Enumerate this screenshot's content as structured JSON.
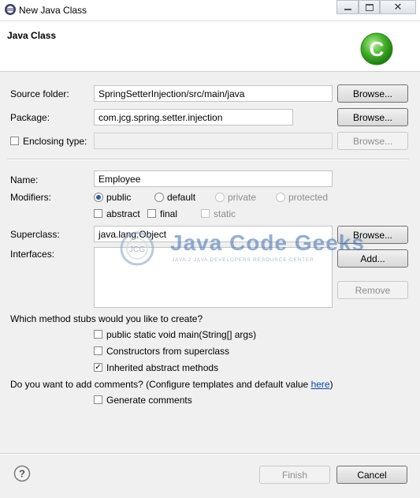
{
  "window": {
    "title": "New Java Class"
  },
  "header": {
    "title": "Java Class",
    "icon": "class-c-icon",
    "accent": "#43b02a"
  },
  "form": {
    "source_folder": {
      "label": "Source folder:",
      "value": "SpringSetterInjection/src/main/java",
      "button": "Browse..."
    },
    "package": {
      "label": "Package:",
      "value": "com.jcg.spring.setter.injection",
      "button": "Browse..."
    },
    "enclosing_type": {
      "label": "Enclosing type:",
      "checked": false,
      "value": "",
      "button": "Browse..."
    },
    "name": {
      "label": "Name:",
      "value": "Employee"
    },
    "modifiers": {
      "label": "Modifiers:",
      "access": [
        "public",
        "default",
        "private",
        "protected"
      ],
      "selected": "public",
      "other": [
        "abstract",
        "final",
        "static"
      ]
    },
    "superclass": {
      "label": "Superclass:",
      "value": "java.lang.Object",
      "button": "Browse..."
    },
    "interfaces": {
      "label": "Interfaces:",
      "add_button": "Add...",
      "remove_button": "Remove"
    },
    "stubs": {
      "question": "Which method stubs would you like to create?",
      "options": [
        "public static void main(String[] args)",
        "Constructors from superclass",
        "Inherited abstract methods"
      ],
      "checked": [
        false,
        false,
        true
      ]
    },
    "comments": {
      "question": "Do you want to add comments? (Configure templates and default value ",
      "link": "here",
      "close": ")",
      "option": "Generate comments",
      "checked": false
    }
  },
  "footer": {
    "finish": "Finish",
    "cancel": "Cancel"
  },
  "watermark": {
    "brand": "Java Code Geeks",
    "tagline": "JAVA 2 JAVA DEVELOPERS RESOURCE CENTER",
    "badge": "JCG"
  }
}
